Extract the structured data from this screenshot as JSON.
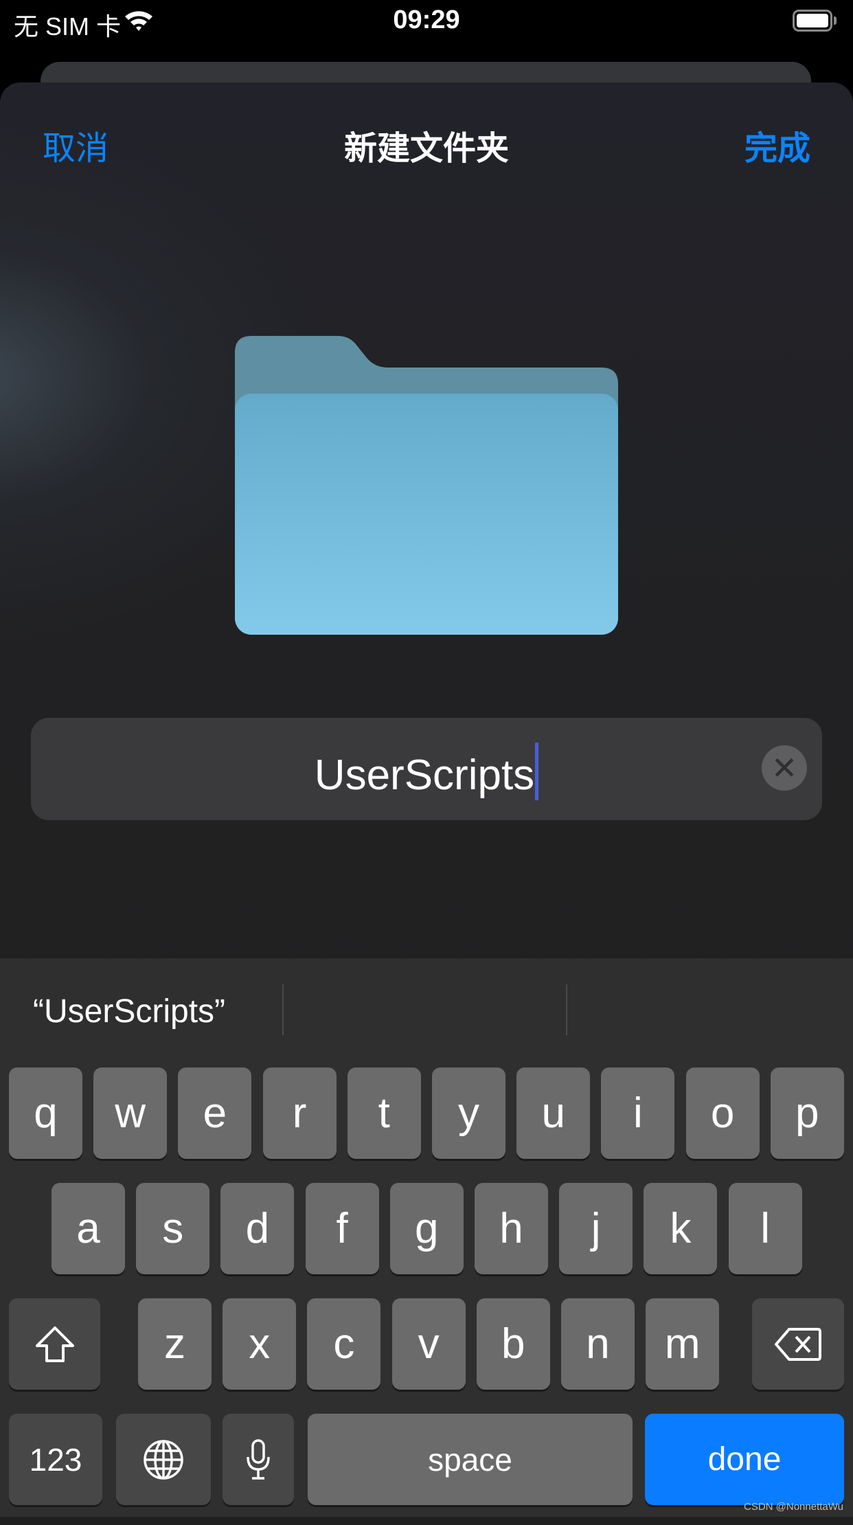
{
  "status_bar": {
    "carrier": "无 SIM 卡",
    "time": "09:29",
    "wifi_icon": "wifi-icon",
    "battery_icon": "battery-full-icon"
  },
  "nav": {
    "cancel": "取消",
    "title": "新建文件夹",
    "done": "完成"
  },
  "folder": {
    "icon": "folder-icon",
    "color": "#7ec4e6"
  },
  "name_field": {
    "value": "UserScripts",
    "clear_icon": "clear-icon"
  },
  "suggestions": [
    "“UserScripts”",
    "",
    ""
  ],
  "keyboard": {
    "rows": [
      [
        "q",
        "w",
        "e",
        "r",
        "t",
        "y",
        "u",
        "i",
        "o",
        "p"
      ],
      [
        "a",
        "s",
        "d",
        "f",
        "g",
        "h",
        "j",
        "k",
        "l"
      ],
      [
        "z",
        "x",
        "c",
        "v",
        "b",
        "n",
        "m"
      ]
    ],
    "numbers": "123",
    "space": "space",
    "done": "done",
    "shift_icon": "shift-icon",
    "delete_icon": "delete-icon",
    "globe_icon": "globe-icon",
    "mic_icon": "microphone-icon"
  },
  "colors": {
    "accent": "#0a84ff",
    "done_key": "#0a7cff"
  },
  "watermark": "CSDN @NonnettaWu"
}
